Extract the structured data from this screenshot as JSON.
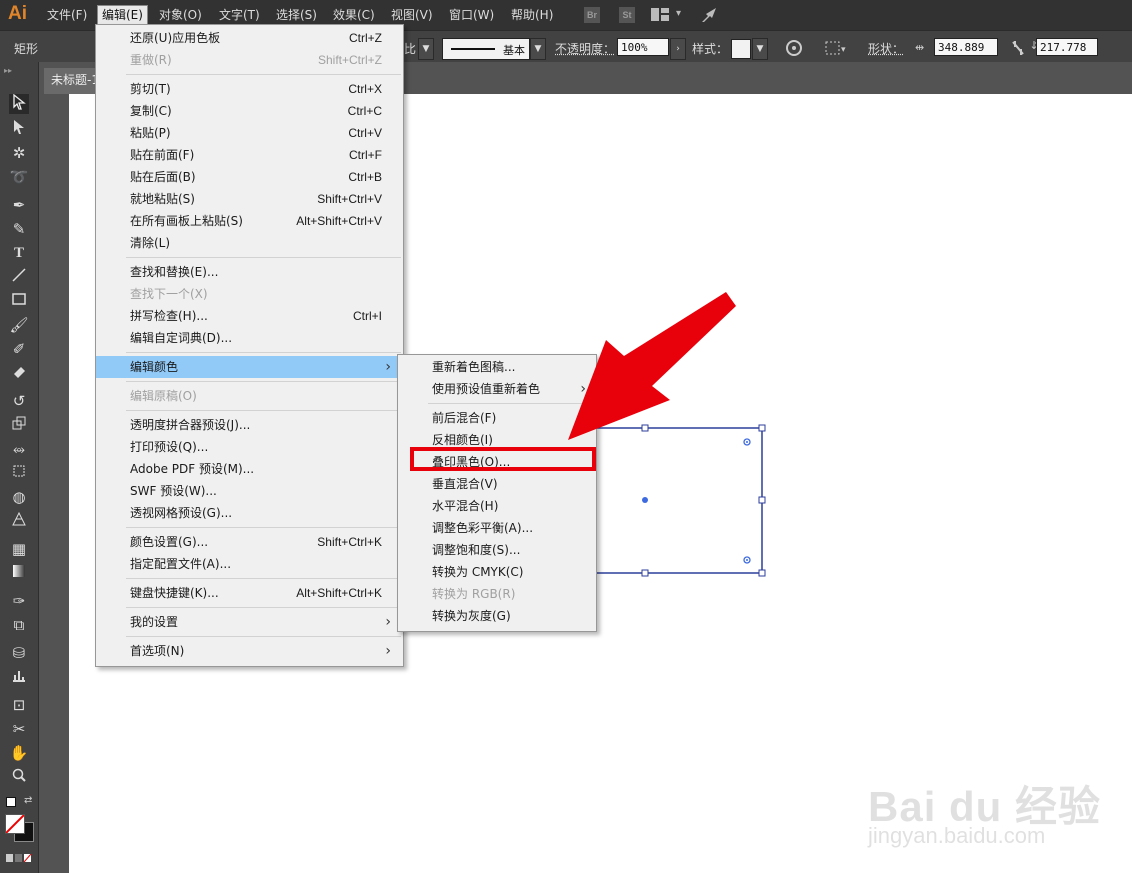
{
  "app": {
    "logo": "Ai"
  },
  "menubar": {
    "items": [
      "文件(F)",
      "编辑(E)",
      "对象(O)",
      "文字(T)",
      "选择(S)",
      "效果(C)",
      "视图(V)",
      "窗口(W)",
      "帮助(H)"
    ],
    "badges": [
      "Br",
      "St"
    ]
  },
  "controlbar": {
    "shape_label": "矩形",
    "ratio_partial": "比",
    "stroke_style": "基本",
    "opacity_label": "不透明度：",
    "opacity_value": "100%",
    "style_label": "样式：",
    "shape_panel_label": "形状：",
    "width_value": "348.889 px",
    "height_value": "217.778 px"
  },
  "document": {
    "tab_title": "未标题-1"
  },
  "edit_menu": {
    "groups": [
      [
        {
          "label": "还原(U)应用色板",
          "shortcut": "Ctrl+Z",
          "disabled": false
        },
        {
          "label": "重做(R)",
          "shortcut": "Shift+Ctrl+Z",
          "disabled": true
        }
      ],
      [
        {
          "label": "剪切(T)",
          "shortcut": "Ctrl+X",
          "disabled": false
        },
        {
          "label": "复制(C)",
          "shortcut": "Ctrl+C",
          "disabled": false
        },
        {
          "label": "粘贴(P)",
          "shortcut": "Ctrl+V",
          "disabled": false
        },
        {
          "label": "贴在前面(F)",
          "shortcut": "Ctrl+F",
          "disabled": false
        },
        {
          "label": "贴在后面(B)",
          "shortcut": "Ctrl+B",
          "disabled": false
        },
        {
          "label": "就地粘贴(S)",
          "shortcut": "Shift+Ctrl+V",
          "disabled": false
        },
        {
          "label": "在所有画板上粘贴(S)",
          "shortcut": "Alt+Shift+Ctrl+V",
          "disabled": false
        },
        {
          "label": "清除(L)",
          "shortcut": "",
          "disabled": false
        }
      ],
      [
        {
          "label": "查找和替换(E)...",
          "shortcut": "",
          "disabled": false
        },
        {
          "label": "查找下一个(X)",
          "shortcut": "",
          "disabled": true
        },
        {
          "label": "拼写检查(H)...",
          "shortcut": "Ctrl+I",
          "disabled": false
        },
        {
          "label": "编辑自定词典(D)...",
          "shortcut": "",
          "disabled": false
        }
      ],
      [
        {
          "label": "编辑颜色",
          "shortcut": "",
          "disabled": false,
          "submenu": true,
          "highlighted": true
        }
      ],
      [
        {
          "label": "编辑原稿(O)",
          "shortcut": "",
          "disabled": true
        }
      ],
      [
        {
          "label": "透明度拼合器预设(J)...",
          "shortcut": "",
          "disabled": false
        },
        {
          "label": "打印预设(Q)...",
          "shortcut": "",
          "disabled": false
        },
        {
          "label": "Adobe PDF 预设(M)...",
          "shortcut": "",
          "disabled": false
        },
        {
          "label": "SWF 预设(W)...",
          "shortcut": "",
          "disabled": false
        },
        {
          "label": "透视网格预设(G)...",
          "shortcut": "",
          "disabled": false
        }
      ],
      [
        {
          "label": "颜色设置(G)...",
          "shortcut": "Shift+Ctrl+K",
          "disabled": false
        },
        {
          "label": "指定配置文件(A)...",
          "shortcut": "",
          "disabled": false
        }
      ],
      [
        {
          "label": "键盘快捷键(K)...",
          "shortcut": "Alt+Shift+Ctrl+K",
          "disabled": false
        }
      ],
      [
        {
          "label": "我的设置",
          "shortcut": "",
          "disabled": false,
          "submenu": true
        }
      ],
      [
        {
          "label": "首选项(N)",
          "shortcut": "",
          "disabled": false,
          "submenu": true
        }
      ]
    ]
  },
  "edit_colors_submenu": {
    "groups": [
      [
        {
          "label": "重新着色图稿...",
          "disabled": false
        },
        {
          "label": "使用预设值重新着色",
          "disabled": false,
          "submenu": true
        }
      ],
      [
        {
          "label": "前后混合(F)",
          "disabled": false
        },
        {
          "label": "反相颜色(I)",
          "disabled": false
        },
        {
          "label": "叠印黑色(O)...",
          "disabled": false,
          "boxed": true
        },
        {
          "label": "垂直混合(V)",
          "disabled": false
        },
        {
          "label": "水平混合(H)",
          "disabled": false
        },
        {
          "label": "调整色彩平衡(A)...",
          "disabled": false
        },
        {
          "label": "调整饱和度(S)...",
          "disabled": false
        },
        {
          "label": "转换为 CMYK(C)",
          "disabled": false
        },
        {
          "label": "转换为 RGB(R)",
          "disabled": true
        },
        {
          "label": "转换为灰度(G)",
          "disabled": false
        }
      ]
    ]
  },
  "annotation": {
    "highlight_color": "#e8000b"
  },
  "watermark": {
    "logo_text": "Bai du 经验",
    "url": "jingyan.baidu.com"
  },
  "colors": {
    "menubar_bg": "#323232",
    "panel_bg": "#424242",
    "workspace_bg": "#535353",
    "menu_bg": "#f0f0f0",
    "menu_highlight": "#91c9f7",
    "selection_blue": "#2b3e9a",
    "app_logo": "#e0852a"
  }
}
